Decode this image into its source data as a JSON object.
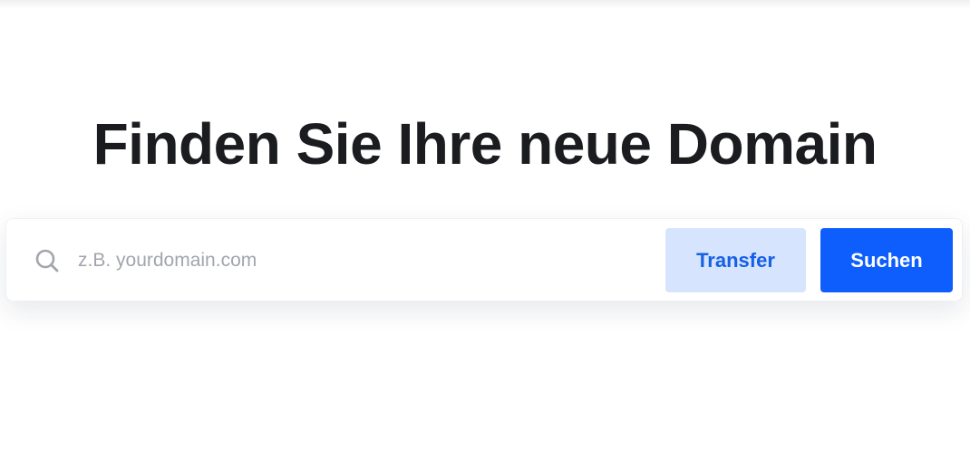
{
  "hero": {
    "title": "Finden Sie Ihre neue Domain"
  },
  "search": {
    "icon": "search-icon",
    "placeholder": "z.B. yourdomain.com",
    "value": "",
    "transfer_label": "Transfer",
    "search_label": "Suchen"
  },
  "colors": {
    "title": "#1b1c20",
    "primary": "#0d5efc",
    "secondary_bg": "#d6e4fd",
    "secondary_text": "#1560e6",
    "placeholder": "#a2a5ae"
  }
}
